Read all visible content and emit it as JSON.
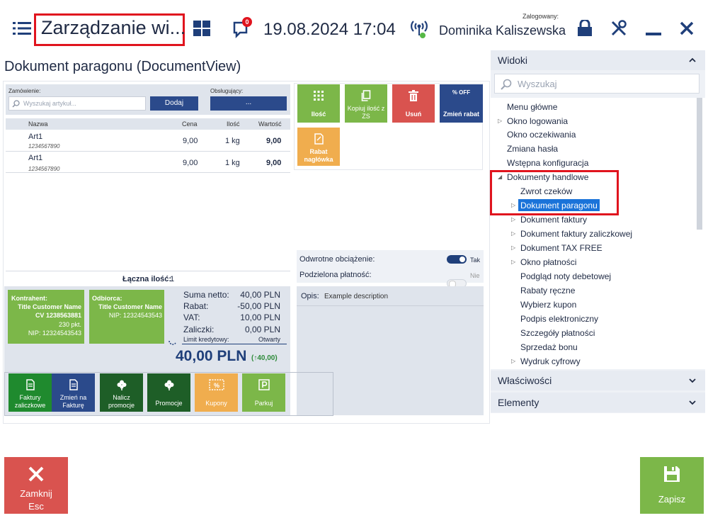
{
  "topbar": {
    "title": "Zarządzanie wi...",
    "datetime": "19.08.2024 17:04",
    "notification_count": "0",
    "logged_label": "Zalogowany:",
    "user_name": "Dominika Kaliszewska"
  },
  "document": {
    "title": "Dokument paragonu (DocumentView)",
    "order_label": "Zamówienie:",
    "search_placeholder": "Wyszukaj artykuł...",
    "add_label": "Dodaj",
    "served_label": "Obsługujący:",
    "served_value": "...",
    "columns": {
      "name": "Nazwa",
      "price": "Cena",
      "qty": "Ilość",
      "value": "Wartość"
    },
    "rows": [
      {
        "name": "Art1",
        "code": "1234567890",
        "price": "9,00",
        "qty": "1 kg",
        "value": "9,00"
      },
      {
        "name": "Art1",
        "code": "1234567890",
        "price": "9,00",
        "qty": "1 kg",
        "value": "9,00"
      }
    ],
    "total_qty_label": "Łączna ilość:",
    "total_qty": "1"
  },
  "actions": {
    "qty": "Ilość",
    "copy_qty": "Kopiuj ilość z ZS",
    "delete": "Usuń",
    "change_discount": "Zmień rabat",
    "off_text": "% OFF",
    "header_discount": "Rabat nagłówka"
  },
  "options": {
    "reverse_charge_label": "Odwrotne obciążenie:",
    "reverse_charge_state": "Tak",
    "split_payment_label": "Podzielona płatność:",
    "split_payment_state": "Nie",
    "description_label": "Opis:",
    "description_value": "Example description"
  },
  "customer": {
    "contractor_label": "Kontrahent:",
    "contractor_name": "Title Customer Name",
    "contractor_code": "CV 1238563881",
    "contractor_points": "230 pkt.",
    "contractor_nip": "NIP: 12324543543",
    "recipient_label": "Odbiorca:",
    "recipient_name": "Title Customer Name",
    "recipient_nip": "NIP: 12324543543"
  },
  "summary": {
    "net_label": "Suma netto:",
    "net_value": "40,00 PLN",
    "discount_label": "Rabat:",
    "discount_value": "-50,00 PLN",
    "vat_label": "VAT:",
    "vat_value": "10,00 PLN",
    "advance_label": "Zaliczki:",
    "advance_value": "0,00 PLN",
    "credit_label": "Limit kredytowy:",
    "credit_value": "Otwarty",
    "total": "40,00 PLN",
    "total_change": "(↑40,00)"
  },
  "bottom_tiles": {
    "advance_invoices": "Faktury zaliczkowe",
    "change_to_invoice": "Zmień na Fakturę",
    "apply_promotions": "Nalicz promocje",
    "promotions": "Promocje",
    "coupons": "Kupony",
    "park": "Parkuj"
  },
  "right_panel": {
    "views_header": "Widoki",
    "search_placeholder": "Wyszukaj",
    "tree": [
      "Menu główne",
      "Okno logowania",
      "Okno oczekiwania",
      "Zmiana hasła",
      "Wstępna konfiguracja",
      "Dokumenty handlowe",
      "Zwrot czeków",
      "Dokument paragonu",
      "Dokument faktury",
      "Dokument faktury zaliczkowej",
      "Dokument TAX FREE",
      "Okno płatności",
      "Podgląd noty debetowej",
      "Rabaty ręczne",
      "Wybierz kupon",
      "Podpis elektroniczny",
      "Szczegóły płatności",
      "Sprzedaż bonu",
      "Wydruk cyfrowy"
    ],
    "properties_header": "Właściwości",
    "elements_header": "Elementy"
  },
  "footer": {
    "close_label": "Zamknij",
    "close_key": "Esc",
    "save_label": "Zapisz"
  },
  "colors": {
    "navy": "#2b4a8b",
    "green": "#7cb749",
    "dark_green": "#1f7a2e",
    "red": "#d9534f",
    "orange": "#f0ad4e",
    "highlight_red": "#e0141e",
    "selected_blue": "#1a73d9"
  }
}
